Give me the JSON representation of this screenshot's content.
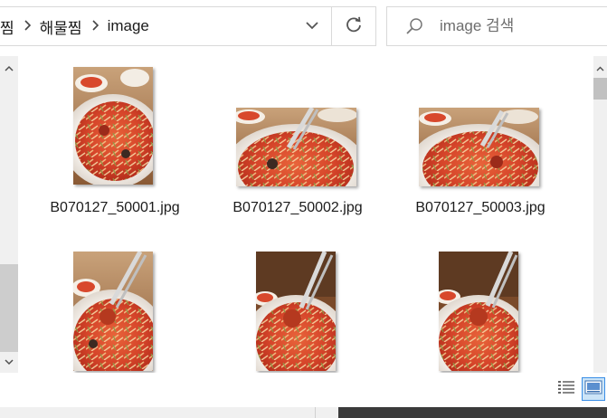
{
  "breadcrumb": {
    "items": [
      "찜",
      "해물찜",
      "image"
    ]
  },
  "search": {
    "placeholder": "image 검색",
    "value": ""
  },
  "icons": {
    "separator": "chevron-right-icon",
    "dropdown": "chevron-down-icon",
    "refresh": "refresh-icon",
    "search": "search-icon",
    "scroll_up": "chevron-up-icon",
    "scroll_down": "chevron-down-icon",
    "details_view": "details-view-icon",
    "thumbnail_view": "large-icons-view-icon"
  },
  "files": [
    {
      "name": "B070127_50001.jpg",
      "orientation": "portrait"
    },
    {
      "name": "B070127_50002.jpg",
      "orientation": "landscape"
    },
    {
      "name": "B070127_50003.jpg",
      "orientation": "landscape"
    },
    {
      "name": "",
      "orientation": "portrait"
    },
    {
      "name": "",
      "orientation": "portrait"
    },
    {
      "name": "",
      "orientation": "portrait"
    }
  ],
  "colors": {
    "border": "#d9d9d9",
    "scroll_track": "#f0f0f0",
    "selected_view": "#cce4f7",
    "selected_view_border": "#3a8ee6"
  }
}
